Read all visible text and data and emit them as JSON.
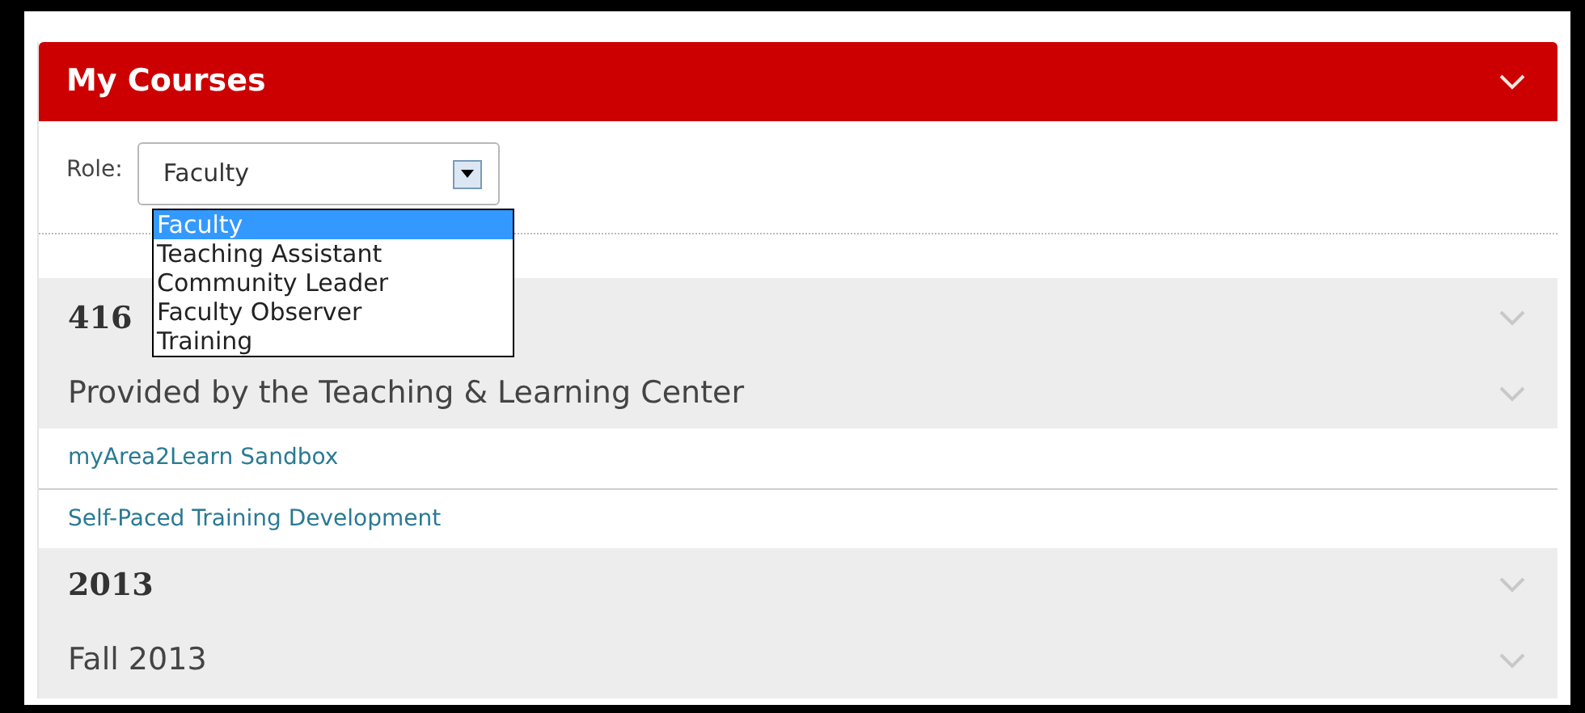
{
  "panel": {
    "title": "My Courses"
  },
  "role": {
    "label": "Role:",
    "value": "Faculty",
    "options": [
      {
        "label": "Faculty",
        "selected": true
      },
      {
        "label": "Teaching Assistant",
        "selected": false
      },
      {
        "label": "Community Leader",
        "selected": false
      },
      {
        "label": "Faculty Observer",
        "selected": false
      },
      {
        "label": "Training",
        "selected": false
      }
    ]
  },
  "rows": [
    {
      "kind": "year",
      "text": "416"
    },
    {
      "kind": "group",
      "text": "Provided by the Teaching & Learning Center"
    },
    {
      "kind": "course",
      "text": "myArea2Learn Sandbox"
    },
    {
      "kind": "course",
      "text": "Self-Paced Training Development"
    },
    {
      "kind": "year",
      "text": "2013"
    },
    {
      "kind": "group",
      "text": "Fall 2013"
    }
  ]
}
